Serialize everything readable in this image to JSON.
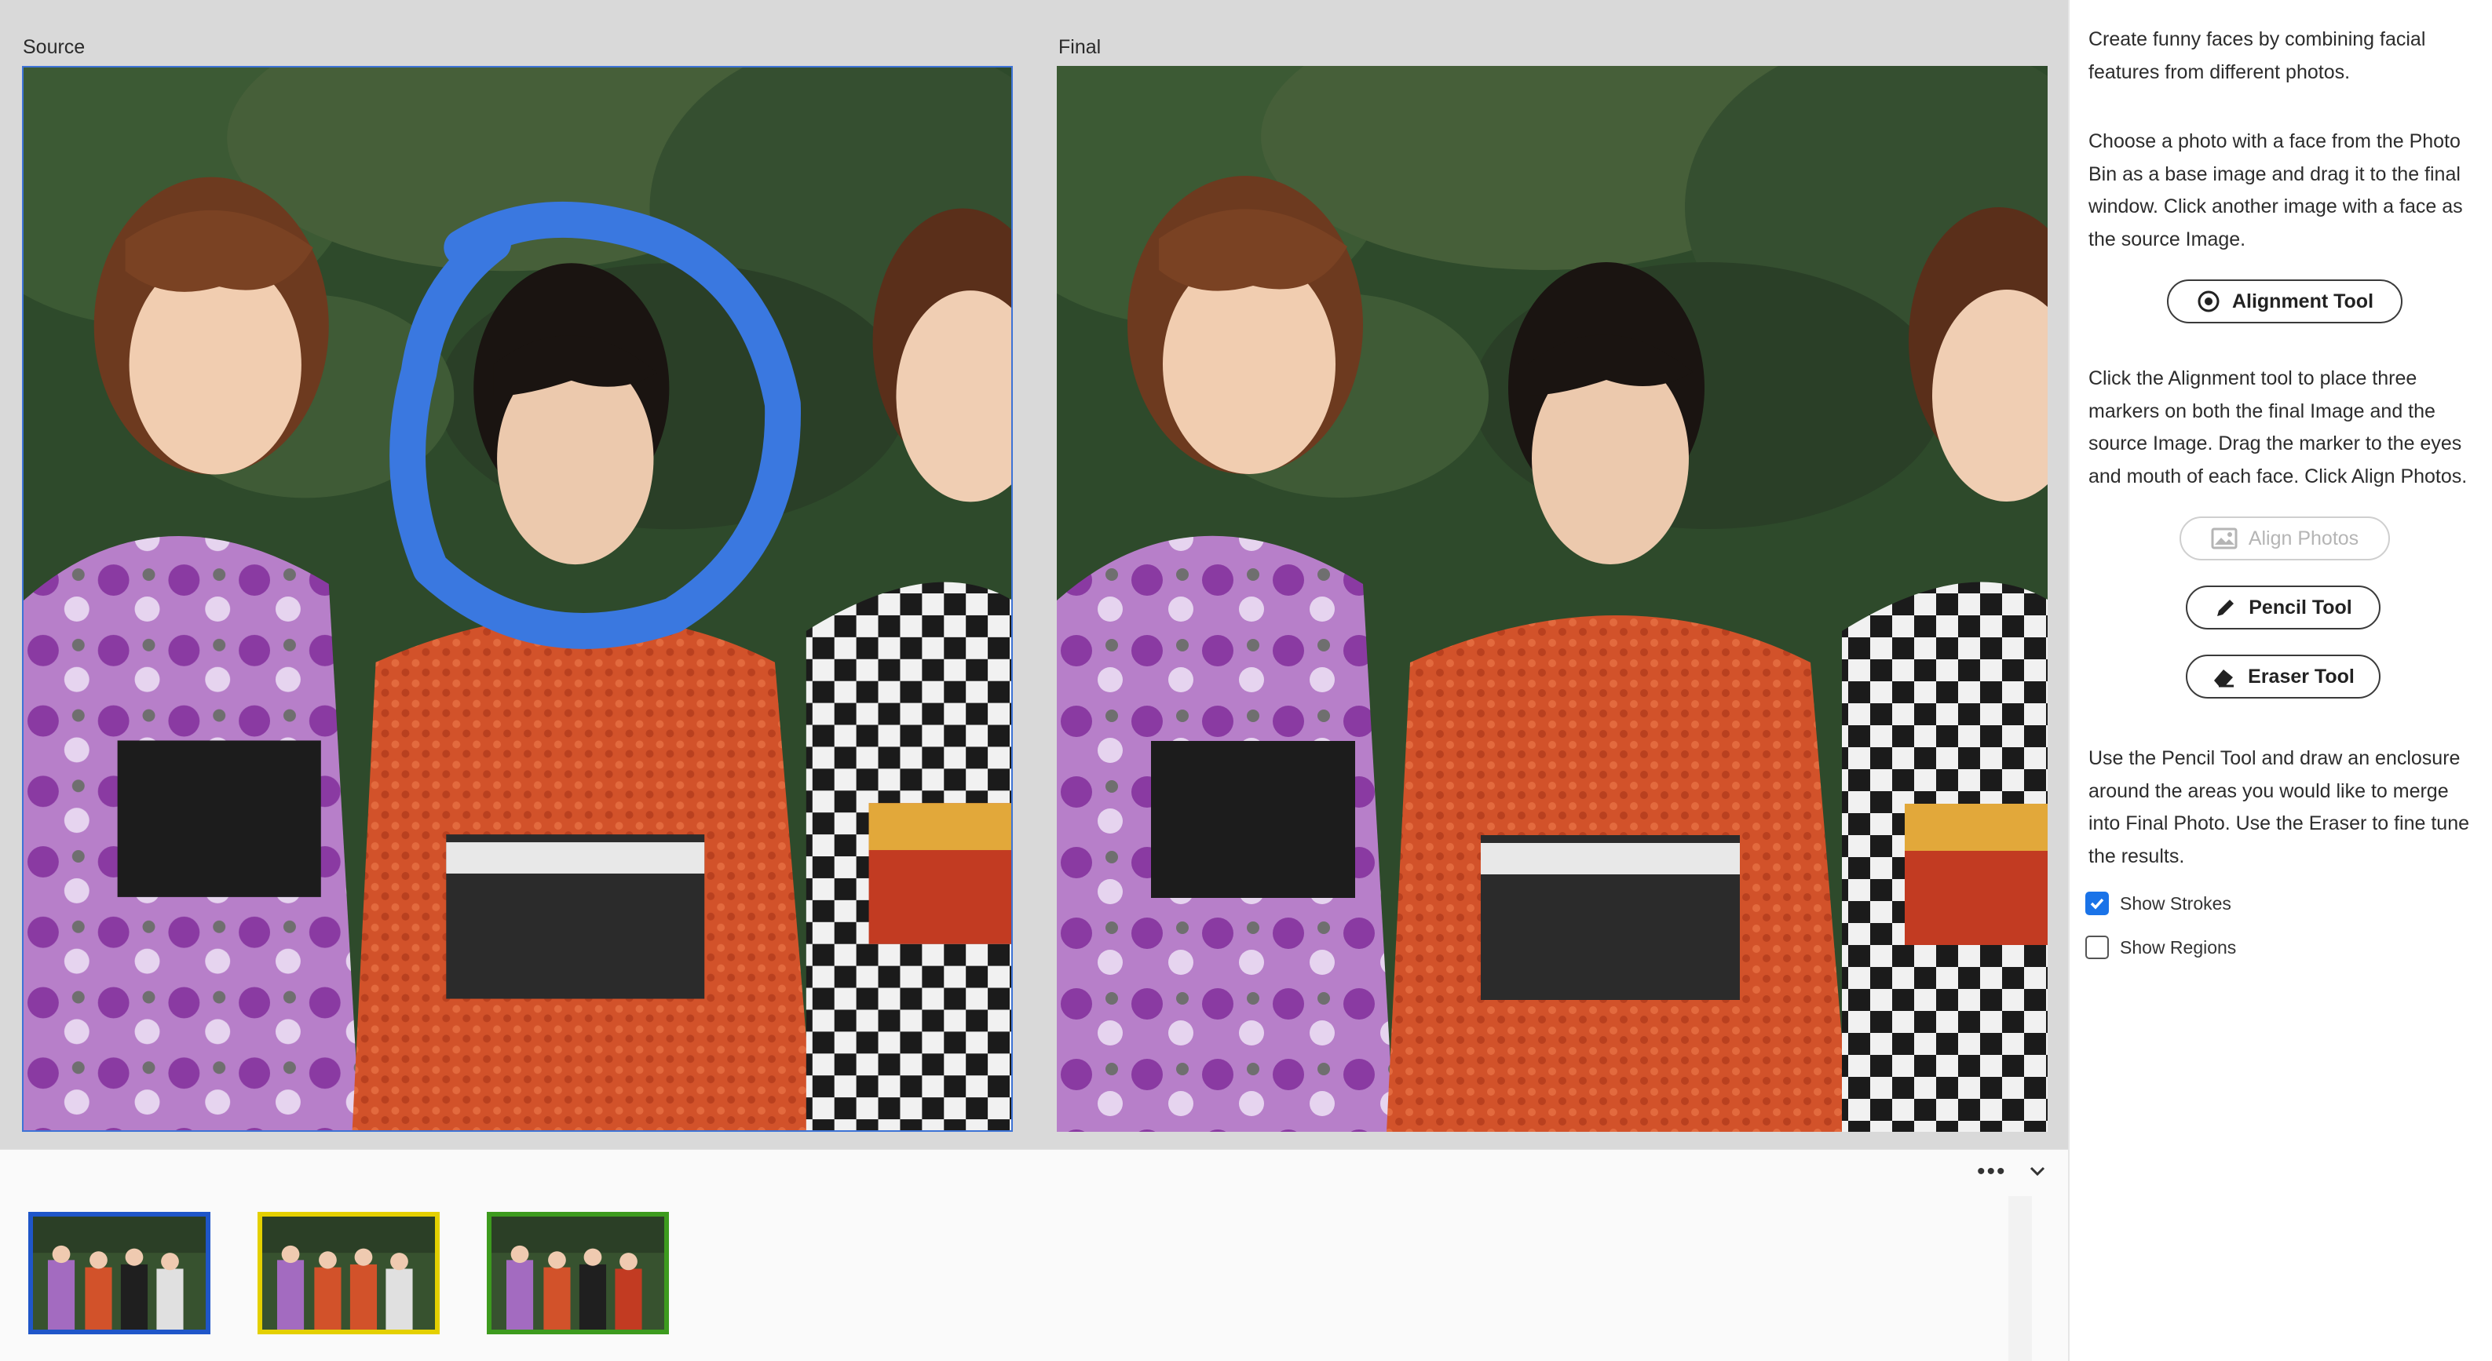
{
  "stage": {
    "source_label": "Source",
    "final_label": "Final"
  },
  "bin": {
    "more_icon": "ellipsis-icon",
    "collapse_icon": "chevron-down-icon",
    "thumbnails": [
      {
        "border_color": "#1f56c9",
        "selected": true
      },
      {
        "border_color": "#e4d000",
        "selected": false
      },
      {
        "border_color": "#3d9b1e",
        "selected": false
      }
    ]
  },
  "panel": {
    "intro": "Create funny faces by combining facial features from different photos.",
    "choose_text": "Choose a photo with a face from the Photo Bin as a base image and drag it to the final window. Click another image with a face as the source Image.",
    "alignment_tool_label": "Alignment Tool",
    "alignment_text": "Click the Alignment tool to place three markers on both the final Image and the source Image. Drag the marker to the eyes and mouth of each face. Click Align Photos.",
    "align_photos_label": "Align Photos",
    "pencil_tool_label": "Pencil Tool",
    "eraser_tool_label": "Eraser Tool",
    "pencil_text": "Use the Pencil Tool and draw an enclosure around the areas you would like to merge into Final Photo. Use the Eraser to fine tune the results.",
    "show_strokes_label": "Show Strokes",
    "show_strokes_checked": true,
    "show_regions_label": "Show Regions",
    "show_regions_checked": false
  },
  "colors": {
    "stroke_blue": "#3a78e0",
    "accent": "#1a73e8"
  }
}
